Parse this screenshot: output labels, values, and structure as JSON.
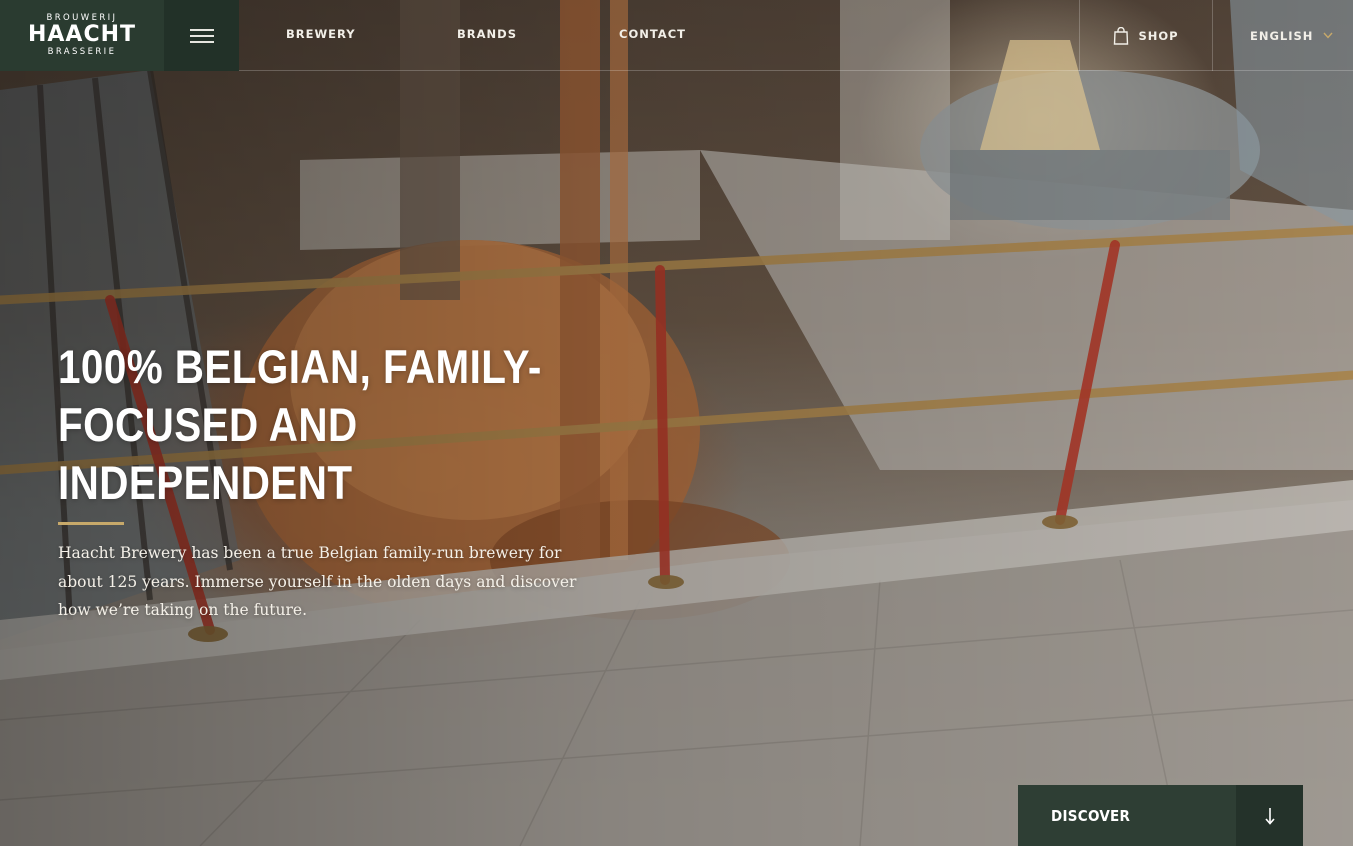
{
  "brand": {
    "logo_top": "BROUWERIJ",
    "logo_main": "HAACHT",
    "logo_bottom": "BRASSERIE"
  },
  "nav": {
    "menu_icon": "hamburger-menu-icon",
    "items": [
      {
        "label": "BREWERY"
      },
      {
        "label": "BRANDS"
      },
      {
        "label": "CONTACT"
      }
    ],
    "shop": {
      "label": "SHOP",
      "icon": "shopping-bag-icon"
    },
    "language": {
      "label": "ENGLISH",
      "icon": "chevron-down-icon"
    }
  },
  "hero": {
    "title_line1": "100% BELGIAN, FAMILY-",
    "title_line2": "FOCUSED AND INDEPENDENT",
    "description": "Haacht Brewery has been a true Belgian family-run brewery for about 125 years. Immerse yourself in the olden days and discover how we’re taking on the future.",
    "background_icon": "brewery-interior-photo"
  },
  "cta": {
    "label": "DISCOVER",
    "icon": "arrow-down-icon"
  },
  "colors": {
    "logo_bg": "#2a3b30",
    "menu_bg": "#223128",
    "accent_rule": "#c7a96a",
    "cta_bg": "#2e3e34",
    "cta_arrow_bg": "#24322a",
    "text_light": "#f2efe8"
  }
}
